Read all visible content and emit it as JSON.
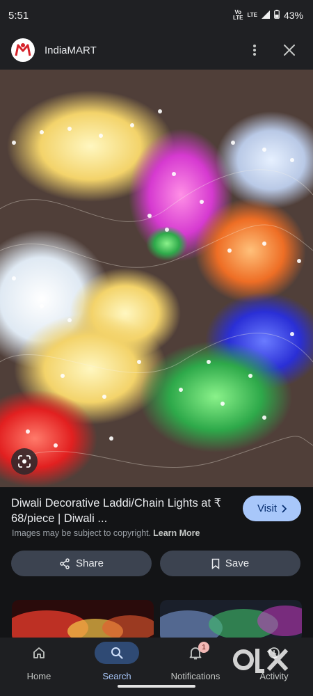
{
  "status_bar": {
    "time": "5:51",
    "net_top": "Vo",
    "net_mid": "LTE",
    "net_lte": "LTE",
    "battery": "43%",
    "icons": [
      "volte-icon",
      "signal-icon",
      "battery-icon"
    ]
  },
  "header": {
    "site_name": "IndiaMART",
    "icons": [
      "indiamart-logo",
      "more-vert-icon",
      "close-icon"
    ]
  },
  "image": {
    "description_icon": "lens-icon"
  },
  "result": {
    "title": "Diwali Decorative Laddi/Chain Lights at ₹ 68/piece | Diwali ...",
    "visit_label": "Visit",
    "copyright_text": "Images may be subject to copyright.",
    "learn_more": "Learn More",
    "share_label": "Share",
    "save_label": "Save"
  },
  "bottom_nav": {
    "items": [
      {
        "label": "Home",
        "icon": "home-icon"
      },
      {
        "label": "Search",
        "icon": "search-icon",
        "active": true
      },
      {
        "label": "Notifications",
        "icon": "bell-icon",
        "badge": "1"
      },
      {
        "label": "Activity",
        "icon": "activity-icon"
      }
    ]
  },
  "watermark": {
    "brand": "OLX"
  },
  "colors": {
    "background": "#131416",
    "accent": "#a8c7fa",
    "button": "#3c4350",
    "active_nav": "#2f4a74"
  }
}
